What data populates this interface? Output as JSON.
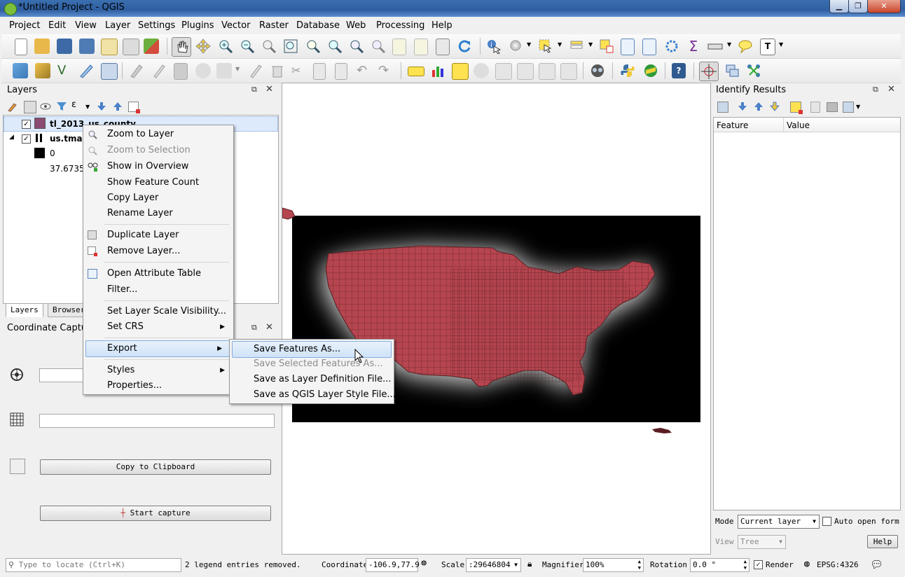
{
  "window": {
    "title": "*Untitled Project - QGIS"
  },
  "menubar": [
    "Project",
    "Edit",
    "View",
    "Layer",
    "Settings",
    "Plugins",
    "Vector",
    "Raster",
    "Database",
    "Web",
    "Processing",
    "Help"
  ],
  "layers_panel": {
    "title": "Layers",
    "layers": [
      {
        "name": "tl_2013_us_county",
        "checked": true,
        "color": "#8c4c74"
      },
      {
        "name": "us.tmax",
        "checked": true,
        "legend": [
          "0",
          "37.6735"
        ]
      }
    ],
    "tabs": [
      "Layers",
      "Browser"
    ]
  },
  "context_menu": {
    "items": [
      "Zoom to Layer",
      "Zoom to Selection",
      "Show in Overview",
      "Show Feature Count",
      "Copy Layer",
      "Rename Layer",
      "Duplicate Layer",
      "Remove Layer...",
      "Open Attribute Table",
      "Filter...",
      "Set Layer Scale Visibility...",
      "Set CRS",
      "Export",
      "Styles",
      "Properties..."
    ],
    "disabled": [
      "Zoom to Selection"
    ]
  },
  "export_submenu": {
    "items": [
      "Save Features As...",
      "Save Selected Features As...",
      "Save as Layer Definition File...",
      "Save as QGIS Layer Style File..."
    ]
  },
  "coordinate_capture": {
    "title": "Coordinate Capture",
    "copy_label": "Copy to Clipboard",
    "start_label": "Start capture"
  },
  "identify": {
    "title": "Identify Results",
    "columns": [
      "Feature",
      "Value"
    ],
    "mode_label": "Mode",
    "mode_value": "Current layer",
    "auto_open_label": "Auto open form",
    "view_label": "View",
    "view_value": "Tree",
    "help_label": "Help"
  },
  "statusbar": {
    "locate_placeholder": "Type to locate (Ctrl+K)",
    "message": "2 legend entries removed.",
    "coordinate_label": "Coordinate",
    "coordinate_value": "-106.9,77.9",
    "scale_label": "Scale",
    "scale_value": ":29646804",
    "magnifier_label": "Magnifier",
    "magnifier_value": "100%",
    "rotation_label": "Rotation",
    "rotation_value": "0.0 °",
    "render_label": "Render",
    "crs": "EPSG:4326"
  },
  "colors": {
    "county_fill": "#b5454f",
    "county_border": "#5a1e22",
    "raster_bg": "#000000"
  }
}
